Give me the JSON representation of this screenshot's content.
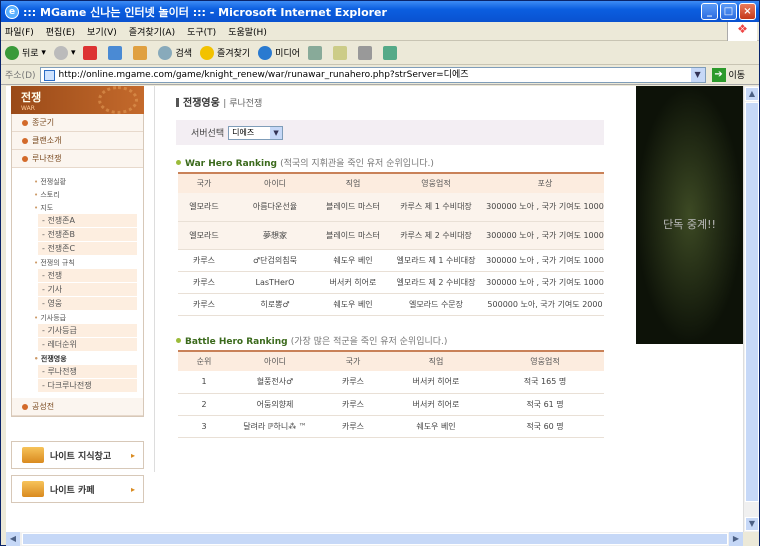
{
  "window": {
    "title": "::: MGame 신나는 인터넷 놀이터 ::: - Microsoft Internet Explorer"
  },
  "menu": [
    "파일(F)",
    "편집(E)",
    "보기(V)",
    "즐겨찾기(A)",
    "도구(T)",
    "도움말(H)"
  ],
  "toolbar": {
    "back": "뒤로",
    "search": "검색",
    "favorites": "즐겨찾기",
    "media": "미디어"
  },
  "address": {
    "label": "주소(D)",
    "url": "http://online.mgame.com/game/knight_renew/war/runawar_runahero.php?strServer=디에즈",
    "go": "이동"
  },
  "sidebar": {
    "title": "전쟁",
    "subtitle": "WAR",
    "menu1": "종군기",
    "menu2": "클랜소개",
    "menu3": "루나전쟁",
    "groups": [
      {
        "label": "전쟁실황",
        "items": []
      },
      {
        "label": "스토리",
        "items": []
      },
      {
        "label": "지도",
        "items": [
          "전쟁존A",
          "전쟁존B",
          "전쟁존C"
        ]
      },
      {
        "label": "전쟁의 규칙",
        "items": [
          "전쟁",
          "기사",
          "영웅"
        ]
      },
      {
        "label": "기사등급",
        "items": [
          "기사등급",
          "레더순위"
        ]
      },
      {
        "label": "전쟁영웅",
        "items": [
          "루나전쟁",
          "다크루나전쟁"
        ],
        "active": true
      }
    ],
    "menu4": "공성전",
    "btn1": "나이트 지식창고",
    "btn2": "나이트 카페"
  },
  "main": {
    "title": "전쟁영웅",
    "crumb": "루나전쟁",
    "server_label": "서버선택",
    "server_value": "디에즈",
    "war_title": "War Hero Ranking",
    "war_desc": "(적국의 지휘관을 죽인 유저 순위입니다.)",
    "war_headers": [
      "국가",
      "아이디",
      "직업",
      "영웅업적",
      "포상"
    ],
    "war_rows": [
      [
        "엘모라드",
        "아름다운선율",
        "블레이드 마스터",
        "카루스 제 1 수비대장",
        "300000 노아 , 국가 기여도 1000"
      ],
      [
        "엘모라드",
        "夢想家",
        "블레이드 마스터",
        "카루스 제 2 수비대장",
        "300000 노아 , 국가 기여도 1000"
      ],
      [
        "카루스",
        "♂단검의침묵",
        "쉐도우 베인",
        "엘모라드 제 1 수비대장",
        "300000 노아 , 국가 기여도 1000"
      ],
      [
        "카루스",
        "LasTHerO",
        "버서커 히어로",
        "엘모라드 제 2 수비대장",
        "300000 노아 , 국가 기여도 1000"
      ],
      [
        "카루스",
        "히로뽕♂",
        "쉐도우 베인",
        "엘모라드 수문장",
        "500000 노아, 국가 기여도 2000"
      ]
    ],
    "battle_title": "Battle Hero Ranking",
    "battle_desc": "(가장 많은 적군을 죽인 유저 순위입니다.)",
    "battle_headers": [
      "순위",
      "아이디",
      "국가",
      "직업",
      "영웅업적"
    ],
    "battle_rows": [
      [
        "1",
        "혈풍전사♂",
        "카루스",
        "버서커 히어로",
        "적국 165 명"
      ],
      [
        "2",
        "어둠의향제",
        "카루스",
        "버서커 히어로",
        "적국 61 명"
      ],
      [
        "3",
        "달려라 ℙ하니⁂ ™",
        "카루스",
        "쉐도우 베인",
        "적국 60 명"
      ]
    ]
  },
  "banner": "단독 중계!!"
}
